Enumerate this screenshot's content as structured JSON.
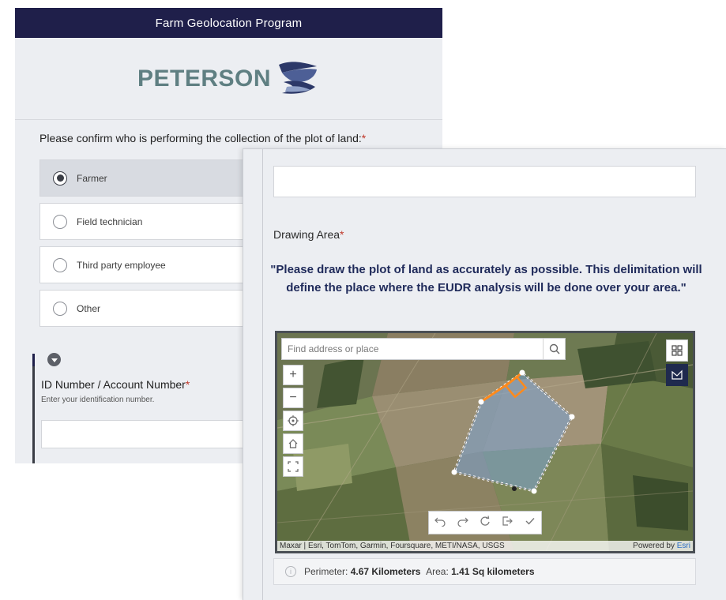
{
  "header": {
    "title": "Farm Geolocation Program"
  },
  "logo": {
    "text": "PETERSON"
  },
  "collector_question": {
    "label": "Please confirm who is performing the collection of the plot of land:",
    "required_mark": "*",
    "options": [
      {
        "label": "Farmer",
        "selected": true
      },
      {
        "label": "Field technician",
        "selected": false
      },
      {
        "label": "Third party employee",
        "selected": false
      },
      {
        "label": "Other",
        "selected": false
      }
    ]
  },
  "id_field": {
    "label": "ID Number / Account Number",
    "required_mark": "*",
    "hint": "Enter your identification number.",
    "value": ""
  },
  "top_field": {
    "value": ""
  },
  "drawing_area": {
    "title": "Drawing Area",
    "required_mark": "*",
    "instructions_pre": "\"Please draw the plot of land as accurately as possible. This delimitation will define the place where the ",
    "instructions_bold": "EUDR",
    "instructions_post": " analysis will be done over your area.\""
  },
  "map": {
    "search_placeholder": "Find address or place",
    "tools": [
      "zoom-in",
      "zoom-out",
      "locate",
      "home",
      "fullscreen"
    ],
    "attribution": "Maxar | Esri, TomTom, Garmin, Foursquare, METI/NASA, USGS",
    "powered_by_prefix": "Powered by ",
    "powered_by_link": "Esri"
  },
  "measurement": {
    "perimeter_label": "Perimeter:",
    "perimeter_value": "4.67 Kilometers",
    "area_label": "Area:",
    "area_value": "1.41 Sq kilometers"
  },
  "colors": {
    "header_bg": "#1f1f4a",
    "accent_text": "#1f2a5a",
    "required": "#c0392b",
    "polygon_fill": "#7aa3d4",
    "selection": "#ff8a1c"
  }
}
